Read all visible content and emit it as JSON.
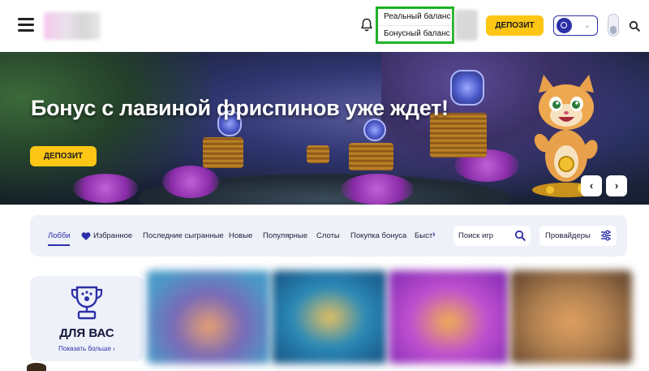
{
  "header": {
    "balance": {
      "real_label": "Реальный баланс",
      "bonus_label": "Бонусный баланс"
    },
    "deposit_label": "ДЕПОЗИТ",
    "icons": [
      "menu-icon",
      "bell-icon",
      "avatar-icon",
      "chevron-down-icon",
      "theme-toggle-icon",
      "search-icon"
    ]
  },
  "banner": {
    "title": "Бонус с лавиной фриспинов уже ждет!",
    "deposit_label": "ДЕПОЗИТ",
    "prev_label": "‹",
    "next_label": "›"
  },
  "tabs": {
    "items": [
      {
        "label": "Лобби"
      },
      {
        "label": "Избранное"
      },
      {
        "label": "Последние сыгранные"
      },
      {
        "label": "Новые"
      },
      {
        "label": "Популярные"
      },
      {
        "label": "Слоты"
      },
      {
        "label": "Покупка бонуса"
      },
      {
        "label": "Быст"
      }
    ],
    "scroll_label": "›",
    "search_placeholder": "Поиск игр",
    "providers_label": "Провайдеры"
  },
  "for_you": {
    "title": "ДЛЯ ВАС",
    "show_more": "Показать больше ›"
  },
  "colors": {
    "accent_yellow": "#fdc614",
    "brand_blue": "#2c2fa8",
    "highlight_green": "#1fb226",
    "panel_bg": "#eef1f8"
  }
}
